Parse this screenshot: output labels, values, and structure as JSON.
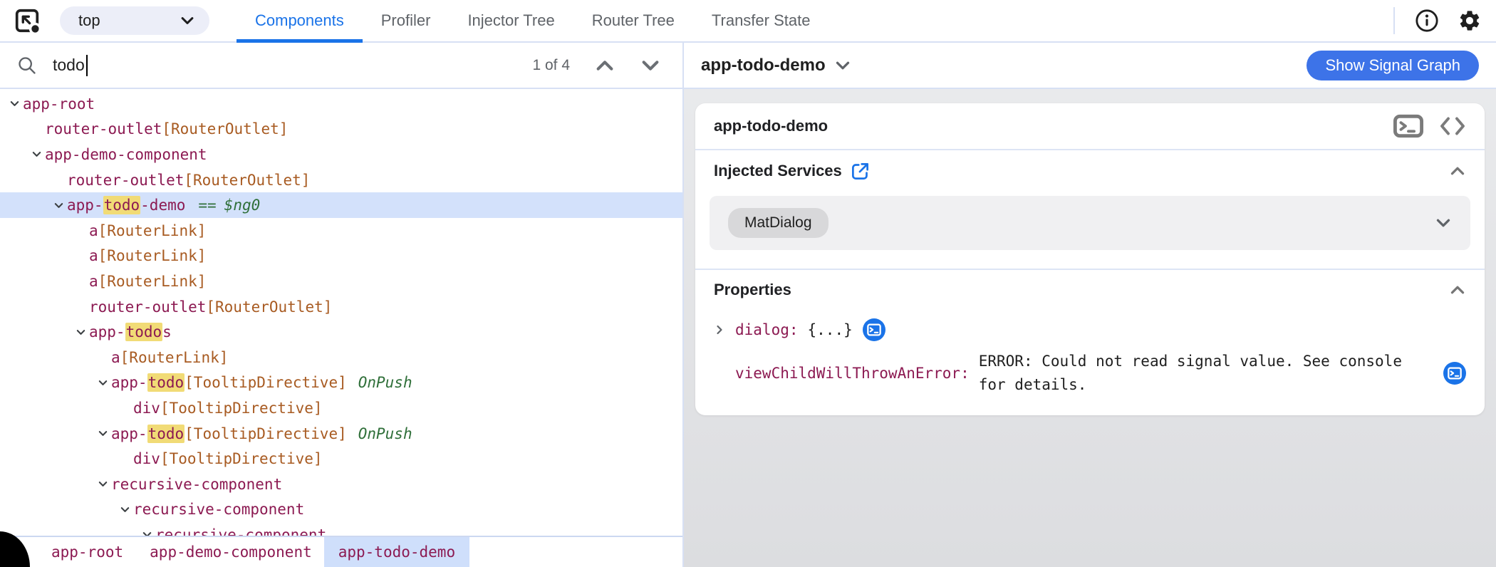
{
  "toolbar": {
    "frame_selector": {
      "value": "top"
    },
    "tabs": [
      {
        "label": "Components",
        "active": true
      },
      {
        "label": "Profiler",
        "active": false
      },
      {
        "label": "Injector Tree",
        "active": false
      },
      {
        "label": "Router Tree",
        "active": false
      },
      {
        "label": "Transfer State",
        "active": false
      }
    ]
  },
  "search": {
    "query": "todo",
    "result_count": "1 of 4"
  },
  "tree": {
    "rows": [
      {
        "level": 0,
        "expandable": true,
        "name": "app-root"
      },
      {
        "level": 1,
        "expandable": false,
        "name": "router-outlet",
        "directive": "[RouterOutlet]"
      },
      {
        "level": 1,
        "expandable": true,
        "name": "app-demo-component"
      },
      {
        "level": 2,
        "expandable": false,
        "name": "router-outlet",
        "directive": "[RouterOutlet]"
      },
      {
        "level": 2,
        "expandable": true,
        "name_pre": "app-",
        "match": "todo",
        "name_post": "-demo",
        "eq": "==",
        "ref": "$ng0",
        "selected": true
      },
      {
        "level": 3,
        "expandable": false,
        "name": "a",
        "directive": "[RouterLink]"
      },
      {
        "level": 3,
        "expandable": false,
        "name": "a",
        "directive": "[RouterLink]"
      },
      {
        "level": 3,
        "expandable": false,
        "name": "a",
        "directive": "[RouterLink]"
      },
      {
        "level": 3,
        "expandable": false,
        "name": "router-outlet",
        "directive": "[RouterOutlet]"
      },
      {
        "level": 3,
        "expandable": true,
        "name_pre": "app-",
        "match": "todo",
        "name_post": "s"
      },
      {
        "level": 4,
        "expandable": false,
        "name": "a",
        "directive": "[RouterLink]"
      },
      {
        "level": 4,
        "expandable": true,
        "name_pre": "app-",
        "match": "todo",
        "directive": "[TooltipDirective]",
        "mode": "OnPush"
      },
      {
        "level": 5,
        "expandable": false,
        "name": "div",
        "directive": "[TooltipDirective]"
      },
      {
        "level": 4,
        "expandable": true,
        "name_pre": "app-",
        "match": "todo",
        "directive": "[TooltipDirective]",
        "mode": "OnPush"
      },
      {
        "level": 5,
        "expandable": false,
        "name": "div",
        "directive": "[TooltipDirective]"
      },
      {
        "level": 4,
        "expandable": true,
        "name": "recursive-component"
      },
      {
        "level": 5,
        "expandable": true,
        "name": "recursive-component"
      },
      {
        "level": 6,
        "expandable": true,
        "name": "recursive-component",
        "clipped": true
      }
    ]
  },
  "breadcrumbs": [
    {
      "label": "app-root",
      "selected": false
    },
    {
      "label": "app-demo-component",
      "selected": false
    },
    {
      "label": "app-todo-demo",
      "selected": true
    }
  ],
  "inspector": {
    "title": "app-todo-demo",
    "show_signal_graph": "Show Signal Graph",
    "card_title": "app-todo-demo",
    "injected_services": {
      "heading": "Injected Services",
      "services": [
        "MatDialog"
      ]
    },
    "properties": {
      "heading": "Properties",
      "rows": [
        {
          "name": "dialog:",
          "value": "{...}"
        },
        {
          "name": "viewChildWillThrowAnError:",
          "value": "ERROR: Could not read signal value. See console for details."
        }
      ]
    }
  },
  "colors": {
    "accent_blue": "#1a73e8",
    "button_blue": "#3d73e8",
    "tab_inactive": "#5f6368",
    "element_name": "#8c1a52",
    "directive": "#a85b22",
    "annotation_green": "#2f6f39",
    "match_highlight": "#f1db76",
    "selected_row": "#d3e1fb",
    "breadcrumb_chip": "#cfdffb",
    "panel_border": "#d7e0f4",
    "panel_bg_top": "#e9eaec",
    "panel_bg_bottom": "#dcdde0"
  }
}
